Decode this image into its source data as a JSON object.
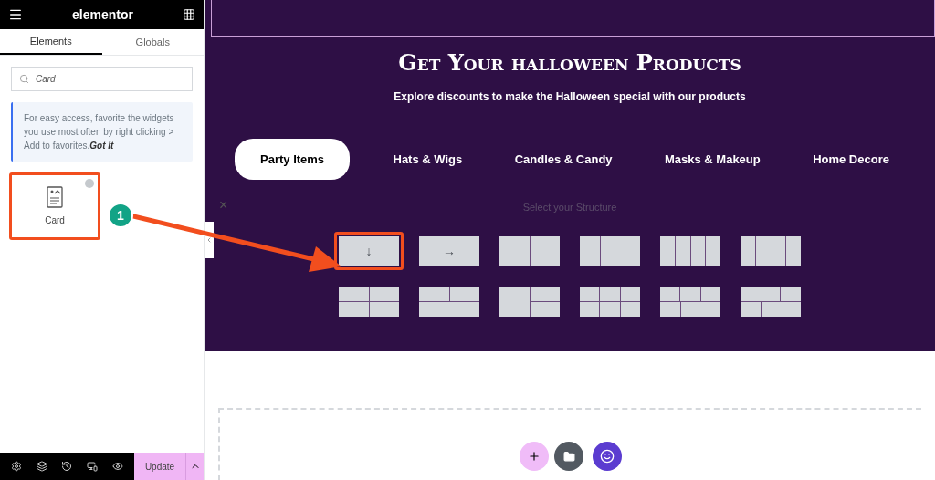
{
  "sidebar": {
    "brand": "elementor",
    "tabs": [
      {
        "label": "Elements",
        "selected": true
      },
      {
        "label": "Globals",
        "selected": false
      }
    ],
    "search": {
      "value": "Card"
    },
    "notice": {
      "text": "For easy access, favorite the widgets you use most often by right clicking > Add to favorites.",
      "link": "Got It"
    },
    "widgets": [
      {
        "label": "Card",
        "selected": true
      }
    ],
    "footer": {
      "update": "Update"
    }
  },
  "canvas": {
    "title": "Get Your halloween Products",
    "subtitle": "Explore discounts to make the Halloween special with our products",
    "tabs": [
      {
        "label": "Party Items",
        "selected": true
      },
      {
        "label": "Hats & Wigs",
        "selected": false
      },
      {
        "label": "Candles & Candy",
        "selected": false
      },
      {
        "label": "Masks & Makeup",
        "selected": false
      },
      {
        "label": "Home Decore",
        "selected": false
      }
    ],
    "structure": {
      "close": "×",
      "heading": "Select your Structure",
      "presets": [
        {
          "kind": "single",
          "glyph": "↓",
          "selected": true
        },
        {
          "kind": "single",
          "glyph": "→",
          "selected": false
        },
        {
          "kind": "halves",
          "selected": false
        },
        {
          "kind": "onetwo",
          "selected": false
        },
        {
          "kind": "quarters",
          "selected": false
        },
        {
          "kind": "onetwoone",
          "selected": false
        },
        {
          "kind": "grid",
          "selected": false
        },
        {
          "kind": "twoone",
          "selected": false
        },
        {
          "kind": "sidestack",
          "selected": false
        },
        {
          "kind": "sixgrid",
          "selected": false
        },
        {
          "kind": "threetwo",
          "selected": false
        },
        {
          "kind": "staggered",
          "selected": false
        }
      ]
    }
  },
  "annotation": {
    "step": "1"
  }
}
